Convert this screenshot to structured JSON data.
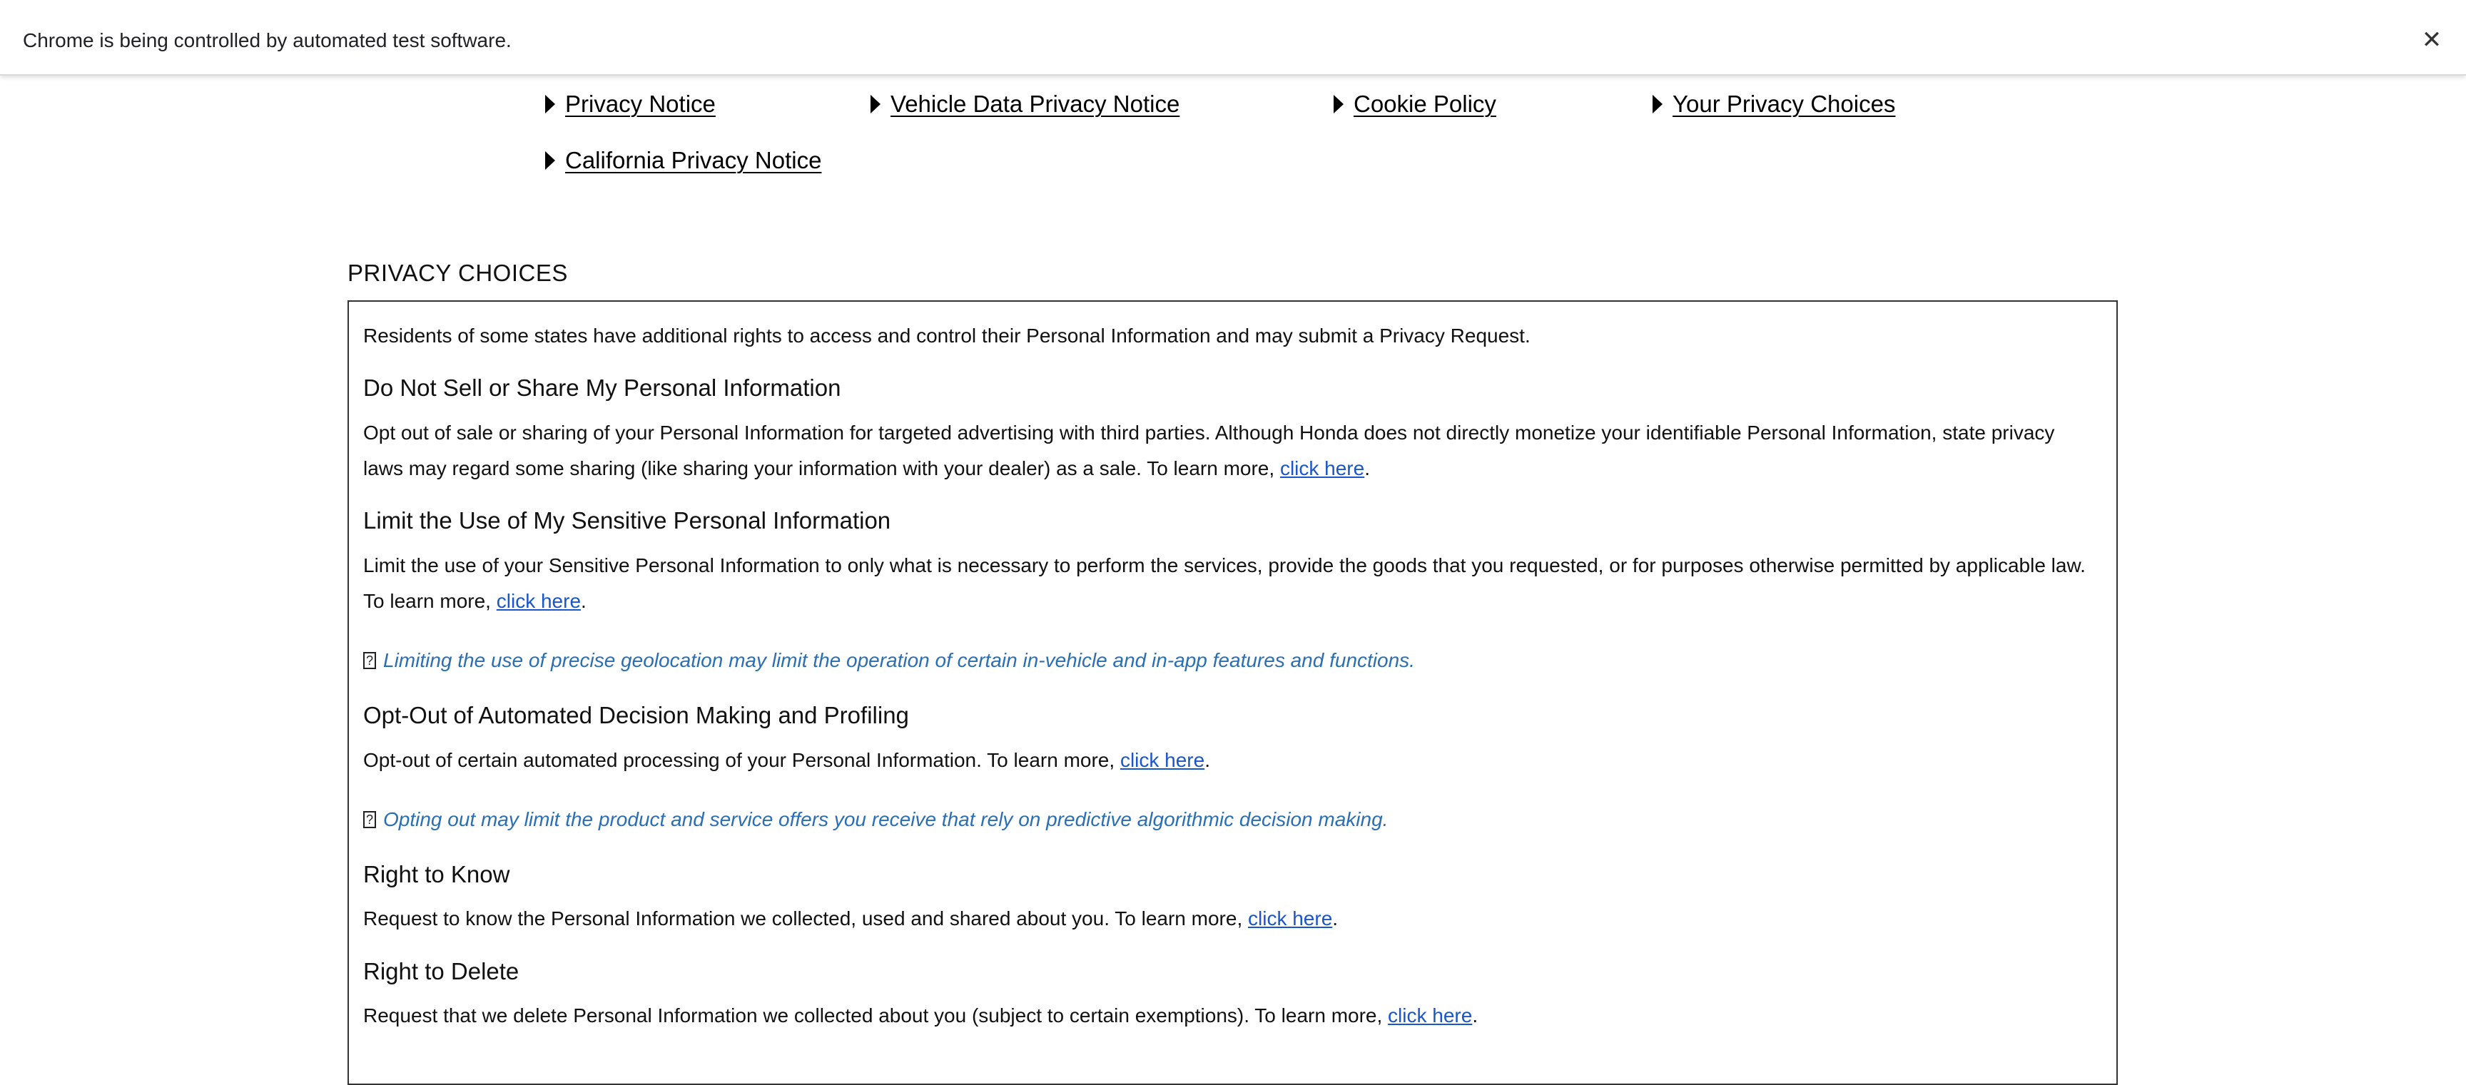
{
  "infobar": {
    "message": "Chrome is being controlled by automated test software.",
    "close_label": "✕"
  },
  "nav": {
    "items": [
      {
        "label": "Privacy Notice"
      },
      {
        "label": "Vehicle Data Privacy Notice"
      },
      {
        "label": "Cookie Policy"
      },
      {
        "label": "Your Privacy Choices"
      },
      {
        "label": "California Privacy Notice"
      }
    ]
  },
  "privacy_choices": {
    "title": "PRIVACY CHOICES",
    "intro": "Residents of some states have additional rights to access and control their Personal Information and may submit a Privacy Request.",
    "sections": [
      {
        "heading": "Do Not Sell or Share My Personal Information",
        "body_before": "Opt out of sale or sharing of your Personal Information for targeted advertising with third parties. Although Honda does not directly monetize your identifiable Personal Information, state privacy laws may regard some sharing (like sharing your information with your dealer) as a sale. To learn more, ",
        "link": "click here",
        "body_after": "."
      },
      {
        "heading": "Limit the Use of My Sensitive Personal Information",
        "body_before": "Limit the use of your Sensitive Personal Information to only what is necessary to perform the services, provide the goods that you requested, or for purposes otherwise permitted by applicable law. To learn more, ",
        "link": "click here",
        "body_after": ".",
        "note": "Limiting the use of precise geolocation may limit the operation of certain in-vehicle and in-app features and functions."
      },
      {
        "heading": "Opt-Out of Automated Decision Making and Profiling",
        "body_before": "Opt-out of certain automated processing of your Personal Information. To learn more, ",
        "link": "click here",
        "body_after": ".",
        "note": "Opting out may limit the product and service offers you receive that rely on predictive algorithmic decision making."
      },
      {
        "heading": "Right to Know",
        "body_before": "Request to know the Personal Information we collected, used and shared about you. To learn more, ",
        "link": "click here",
        "body_after": "."
      },
      {
        "heading": "Right to Delete",
        "body_before": "Request that we delete Personal Information we collected about you (subject to certain exemptions). To learn more, ",
        "link": "click here",
        "body_after": "."
      }
    ],
    "note_icon": "?"
  }
}
